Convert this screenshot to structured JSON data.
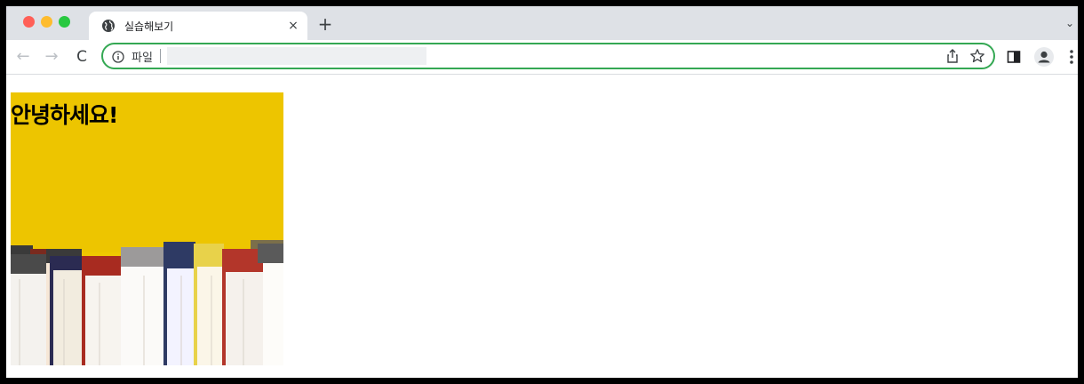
{
  "browser": {
    "tab": {
      "title": "실습해보기",
      "close_glyph": "×"
    },
    "new_tab_glyph": "+",
    "tab_search_glyph": "⌄",
    "nav": {
      "back_glyph": "←",
      "forward_glyph": "→",
      "reload_glyph": "C"
    },
    "omnibox": {
      "scheme_label": "파일",
      "url_value": ""
    },
    "icons": [
      "globe-icon",
      "info-icon",
      "share-icon",
      "star-icon",
      "side-panel-icon",
      "profile-icon",
      "menu-icon"
    ],
    "colors": {
      "omnibox_focus": "#34a853",
      "tabstrip": "#dee1e6"
    }
  },
  "page": {
    "heading": "안녕하세요!",
    "image": {
      "subject": "books-on-yellow-background",
      "background_color": "#f0c800"
    }
  }
}
